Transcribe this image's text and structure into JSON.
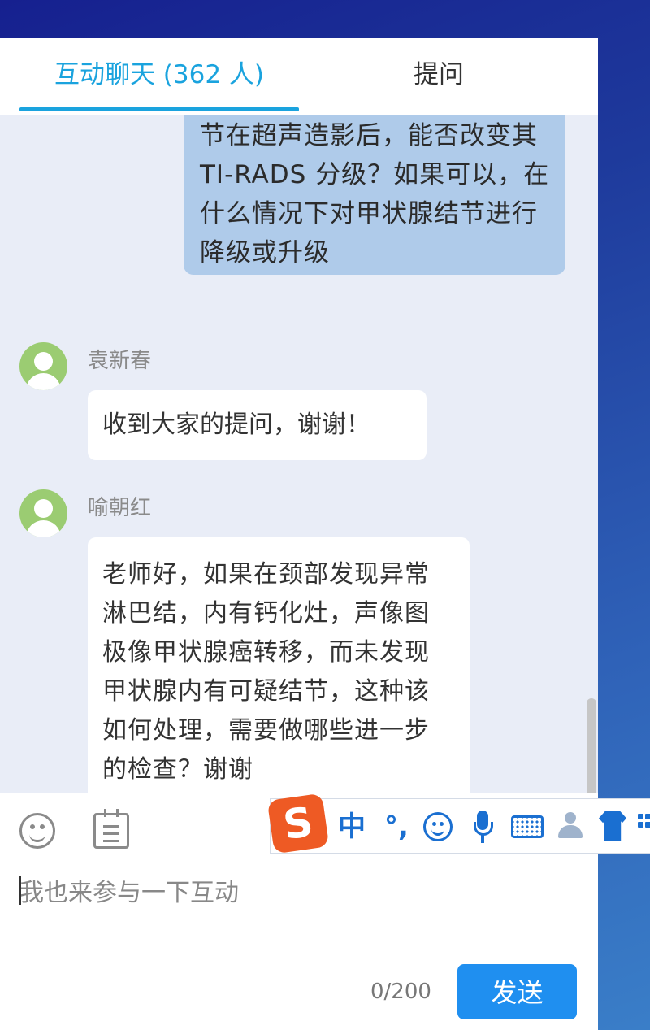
{
  "tabs": [
    {
      "label": "互动聊天 (362 人)",
      "active": true
    },
    {
      "label": "提问",
      "active": false
    }
  ],
  "messages": [
    {
      "type": "self",
      "text": "节在超声造影后，能否改变其TI-RADS 分级？如果可以，在什么情况下对甲状腺结节进行降级或升级"
    },
    {
      "type": "other",
      "sender": "袁新春",
      "avatar_icon": "user-avatar-icon",
      "text": "收到大家的提问，谢谢！"
    },
    {
      "type": "other",
      "sender": "喻朝红",
      "avatar_icon": "user-avatar-icon",
      "text": "老师好，如果在颈部发现异常淋巴结，内有钙化灶，声像图极像甲状腺癌转移，而未发现甲状腺内有可疑结节，这种该如何处理，需要做哪些进一步的检查？谢谢"
    }
  ],
  "toolbar": {
    "icons": [
      "emoji-icon",
      "notepad-icon"
    ]
  },
  "input": {
    "value": "",
    "placeholder": "我也来参与一下互动"
  },
  "counter": "0/200",
  "send_label": "发送",
  "ime": {
    "logo": "S",
    "lang": "中",
    "punct": "°,",
    "icons": [
      "emoji-icon",
      "microphone-icon",
      "keyboard-icon",
      "user-icon",
      "skin-shirt-icon",
      "toolbox-icon"
    ]
  },
  "colors": {
    "accent": "#1aa3de",
    "send_button": "#1f8ff0",
    "self_bubble": "#afcbea",
    "chat_background": "#e9edf7",
    "avatar": "#9bcc72",
    "ime_logo": "#ee5a24",
    "ime_blue": "#1a6fd1"
  }
}
